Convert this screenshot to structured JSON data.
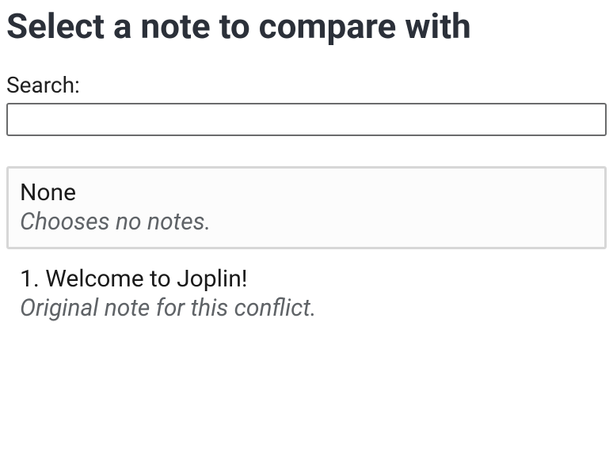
{
  "title": "Select a note to compare with",
  "search": {
    "label": "Search:",
    "value": "",
    "placeholder": ""
  },
  "items": [
    {
      "title": "None",
      "subtitle": "Chooses no notes.",
      "selected": true
    },
    {
      "title": "1. Welcome to Joplin!",
      "subtitle": "Original note for this conflict.",
      "selected": false
    }
  ]
}
